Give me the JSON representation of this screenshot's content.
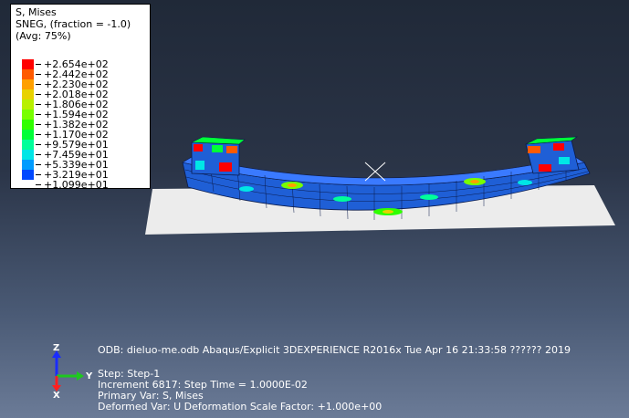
{
  "legend": {
    "title": "S, Mises",
    "subtitle": "SNEG, (fraction = -1.0)",
    "avg": "(Avg: 75%)",
    "levels": [
      {
        "label": "+2.654e+02",
        "color": "#ff0000"
      },
      {
        "label": "+2.442e+02",
        "color": "#ff5a00"
      },
      {
        "label": "+2.230e+02",
        "color": "#ffa000"
      },
      {
        "label": "+2.018e+02",
        "color": "#e8d200"
      },
      {
        "label": "+1.806e+02",
        "color": "#b8f000"
      },
      {
        "label": "+1.594e+02",
        "color": "#78ff00"
      },
      {
        "label": "+1.382e+02",
        "color": "#30ff00"
      },
      {
        "label": "+1.170e+02",
        "color": "#00ff38"
      },
      {
        "label": "+9.579e+01",
        "color": "#00ff9a"
      },
      {
        "label": "+7.459e+01",
        "color": "#00e6e6"
      },
      {
        "label": "+5.339e+01",
        "color": "#009cff"
      },
      {
        "label": "+3.219e+01",
        "color": "#0048ff"
      },
      {
        "label": "+1.099e+01",
        "color": "#0000d2"
      }
    ]
  },
  "info": {
    "line1": "ODB: dieluo-me.odb    Abaqus/Explicit 3DEXPERIENCE R2016x    Tue Apr 16 21:33:58 ?????? 2019",
    "step": "Step: Step-1",
    "increment": "Increment      6817: Step Time =    1.0000E-02",
    "primary": "Primary Var: S, Mises",
    "deformed": "Deformed Var: U   Deformation Scale Factor: +1.000e+00"
  },
  "triad": {
    "z": "Z",
    "y": "Y",
    "x": "X"
  },
  "colors": {
    "plate": "#ececec",
    "beam": "#1f5fd6",
    "grid": "#0a1a4a"
  }
}
